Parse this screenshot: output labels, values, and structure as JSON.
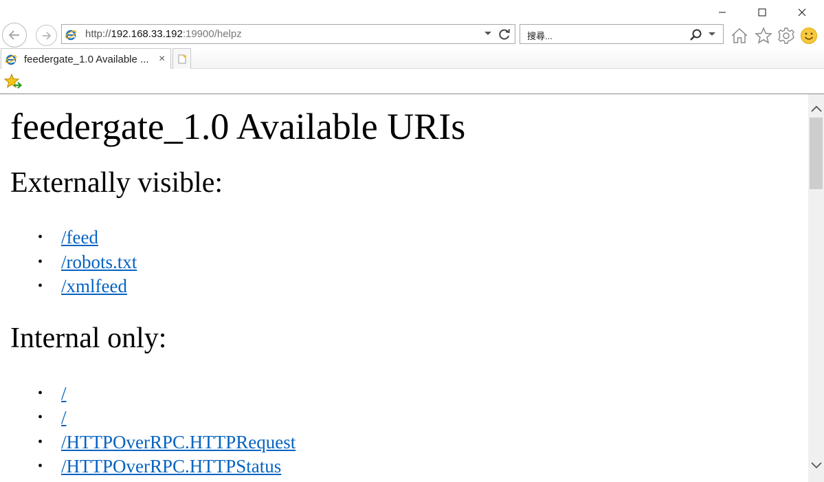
{
  "window": {
    "minimize_icon": "minimize-icon",
    "maximize_icon": "maximize-icon",
    "close_icon": "close-icon"
  },
  "nav": {
    "back_icon": "back-arrow-icon",
    "forward_icon": "forward-arrow-icon"
  },
  "address": {
    "prefix": "http://",
    "host": "192.168.33.192",
    "rest": ":19900/helpz"
  },
  "search": {
    "placeholder": "搜尋..."
  },
  "toolbar": {
    "icons": [
      "home-icon",
      "favorites-star-icon",
      "settings-gear-icon",
      "feedback-smiley-icon"
    ]
  },
  "tab": {
    "title": "feedergate_1.0 Available ...",
    "close": "×"
  },
  "page": {
    "title": "feedergate_1.0 Available URIs",
    "external_heading": "Externally visible:",
    "external_links": [
      "/feed",
      "/robots.txt",
      "/xmlfeed"
    ],
    "internal_heading": "Internal only:",
    "internal_links": [
      "/",
      "/",
      "/HTTPOverRPC.HTTPRequest",
      "/HTTPOverRPC.HTTPStatus"
    ]
  },
  "colors": {
    "link": "#0563c1",
    "ie_blue": "#1b6ec2",
    "ie_ring": "#f2b705"
  }
}
